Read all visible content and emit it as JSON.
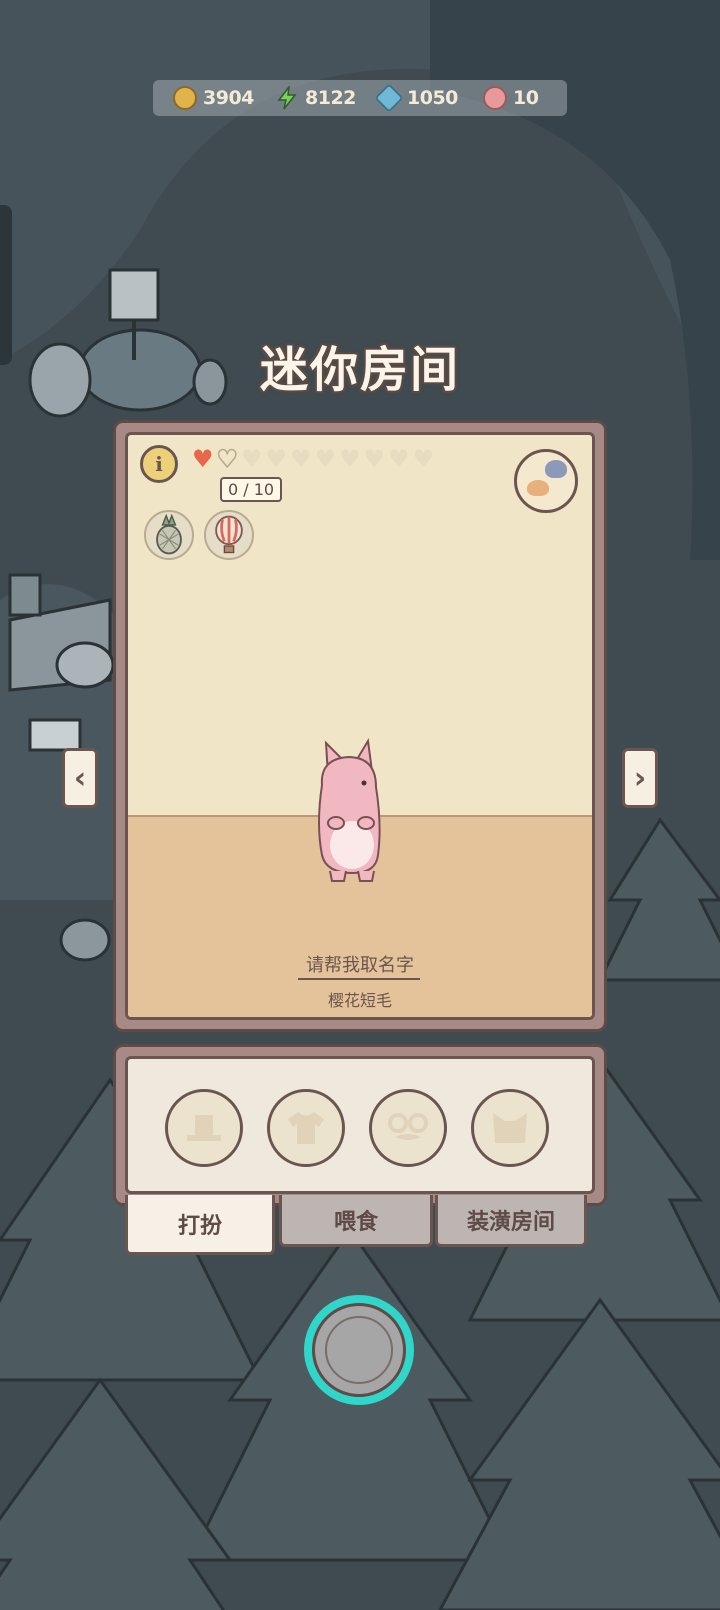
{
  "resources": [
    {
      "name": "coins",
      "icon": "coin-icon",
      "value": "3904"
    },
    {
      "name": "energy",
      "icon": "lightning-icon",
      "value": "8122"
    },
    {
      "name": "gems",
      "icon": "gem-icon",
      "value": "1050"
    },
    {
      "name": "food",
      "icon": "meat-icon",
      "value": "10"
    }
  ],
  "room": {
    "title": "迷你房间",
    "affection": {
      "filled": 1,
      "total": 10,
      "label": "0 / 10"
    },
    "cat_name_prompt": "请帮我取名字",
    "cat_breed": "樱花短毛",
    "badges": [
      "pineapple-icon",
      "hot-air-balloon-icon"
    ]
  },
  "dress_slots": [
    "hat-icon",
    "shirt-icon",
    "glasses-icon",
    "cat-face-icon"
  ],
  "tabs": [
    {
      "label": "打扮",
      "active": true
    },
    {
      "label": "喂食",
      "active": false
    },
    {
      "label": "装潢房间",
      "active": false
    }
  ],
  "colors": {
    "accent": "#2fd6c9",
    "heart": "#e8674a",
    "panel": "#efe8dd",
    "frame": "#a78a86"
  }
}
